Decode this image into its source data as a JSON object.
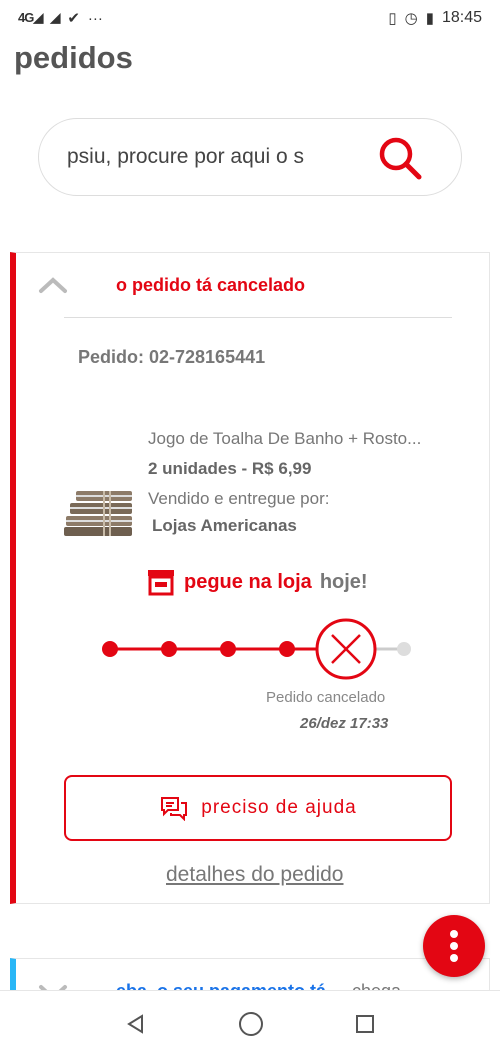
{
  "status_bar": {
    "signal_1": "4G",
    "signal_2": "✕",
    "more": "···",
    "time": "18:45"
  },
  "page": {
    "title": "pedidos"
  },
  "search": {
    "placeholder": "psiu, procure por aqui o s"
  },
  "order": {
    "status": "o pedido tá cancelado",
    "number": "Pedido: 02-728165441",
    "product_name": "Jogo de Toalha De Banho + Rosto...",
    "quantity_price": "2 unidades - R$ 6,99",
    "seller_label": "Vendido e entregue por:",
    "seller": "Lojas Americanas",
    "pickup_label": "pegue na loja",
    "pickup_when": "hoje!",
    "timeline_status": "Pedido cancelado",
    "timeline_date": "26/dez 17:33",
    "help_button": "preciso de ajuda",
    "details_link": "detalhes do pedido"
  },
  "next_order": {
    "status": "eba, o seu pagamento tá",
    "extra": "chega"
  },
  "colors": {
    "brand_red": "#e30613",
    "next_accent": "#29b6f6"
  }
}
